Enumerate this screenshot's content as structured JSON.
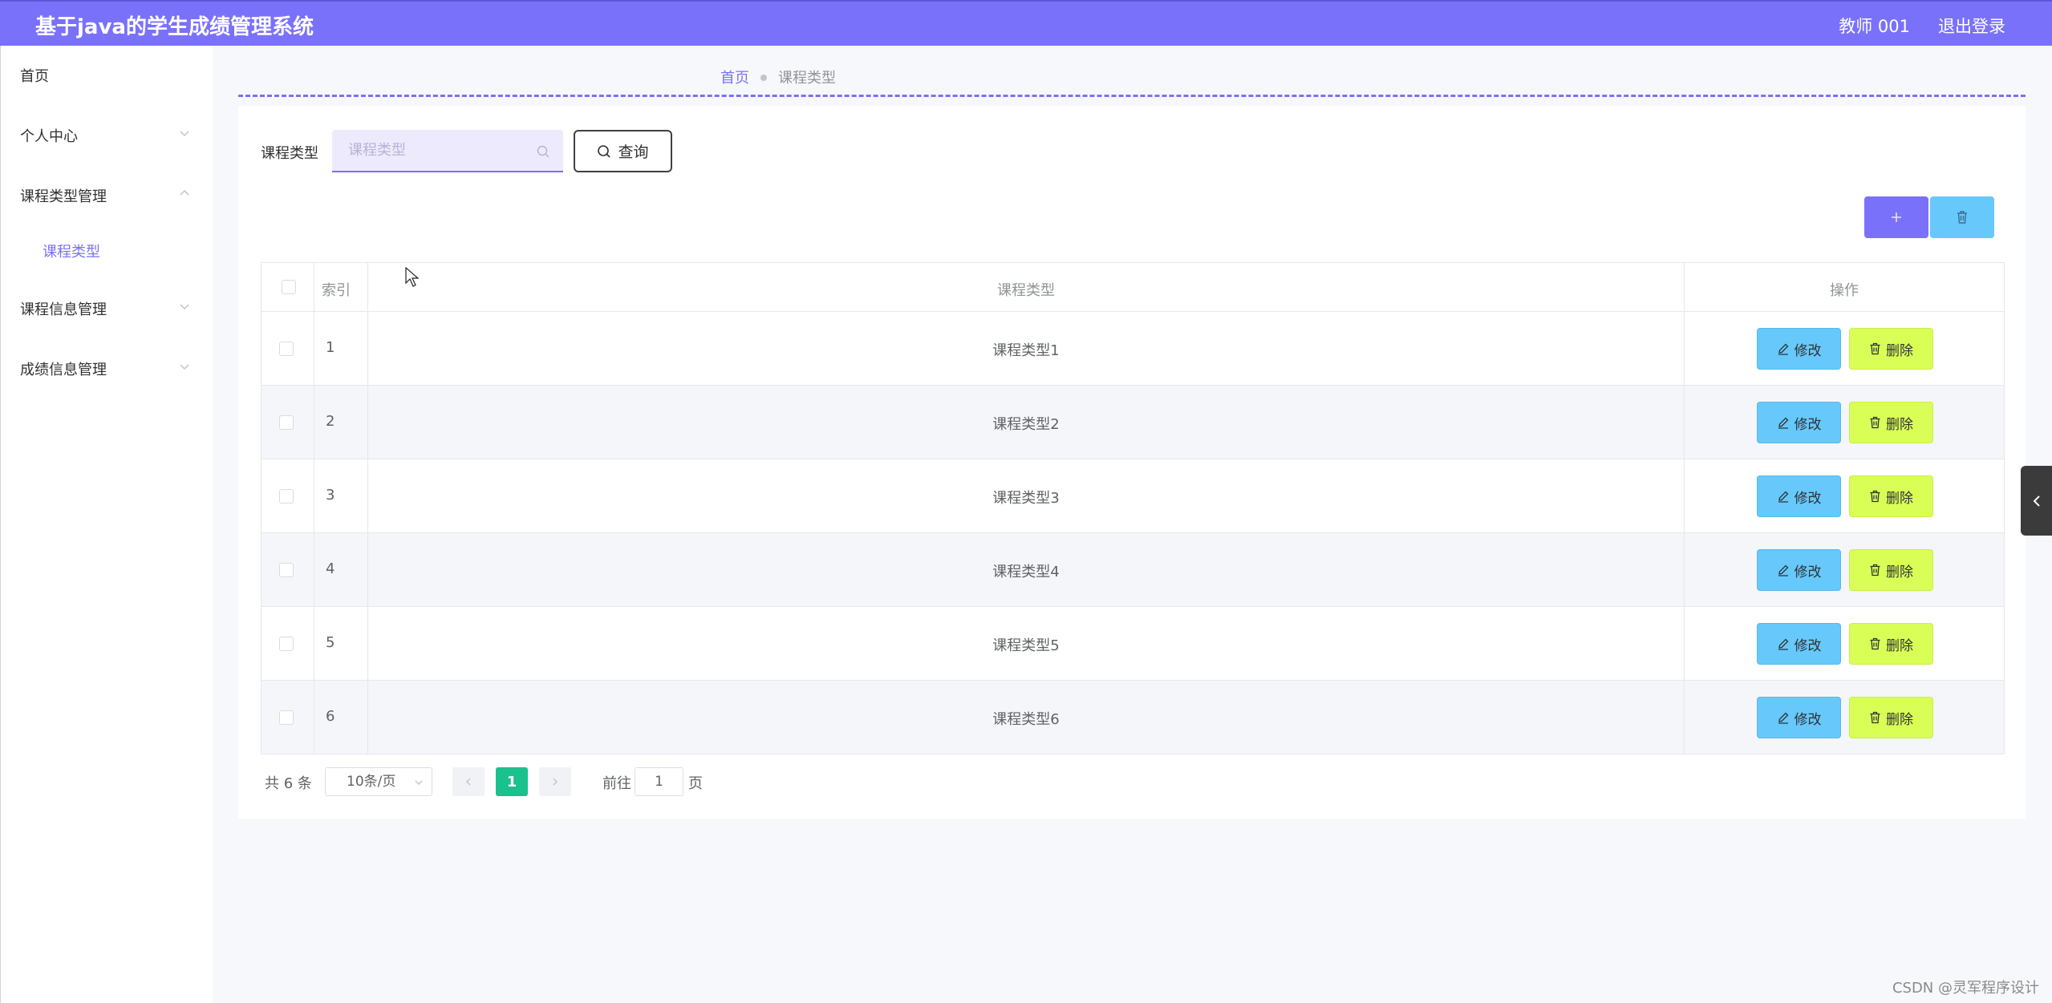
{
  "header": {
    "app_title": "基于java的学生成绩管理系统",
    "user": "教师 001",
    "logout": "退出登录"
  },
  "sidebar": {
    "items": [
      {
        "label": "首页",
        "arrow": "none"
      },
      {
        "label": "个人中心",
        "arrow": "chevron-down-icon"
      },
      {
        "label": "课程类型管理",
        "arrow": "chevron-up-icon"
      },
      {
        "label": "课程类型",
        "arrow": "none",
        "active": true
      },
      {
        "label": "课程信息管理",
        "arrow": "chevron-down-icon"
      },
      {
        "label": "成绩信息管理",
        "arrow": "chevron-down-icon"
      }
    ]
  },
  "breadcrumb": {
    "home": "首页",
    "current": "课程类型"
  },
  "filter": {
    "label": "课程类型",
    "placeholder": "课程类型",
    "value": "",
    "query_button": "查询"
  },
  "table": {
    "columns": [
      "索引",
      "课程类型",
      "操作"
    ],
    "rows": [
      {
        "index": "1",
        "type": "课程类型1"
      },
      {
        "index": "2",
        "type": "课程类型2"
      },
      {
        "index": "3",
        "type": "课程类型3"
      },
      {
        "index": "4",
        "type": "课程类型4"
      },
      {
        "index": "5",
        "type": "课程类型5"
      },
      {
        "index": "6",
        "type": "课程类型6"
      }
    ],
    "edit_label": "修改",
    "delete_label": "删除"
  },
  "pagination": {
    "total": "共 6 条",
    "page_size": "10条/页",
    "current_page": "1",
    "goto_label": "前往",
    "goto_value": "1",
    "page_suffix": "页"
  },
  "colors": {
    "accent": "#7a71fb",
    "edit": "#66c8fb",
    "delete": "#d9ff57",
    "page_active": "#19c28d"
  },
  "watermark": "CSDN @灵军程序设计"
}
